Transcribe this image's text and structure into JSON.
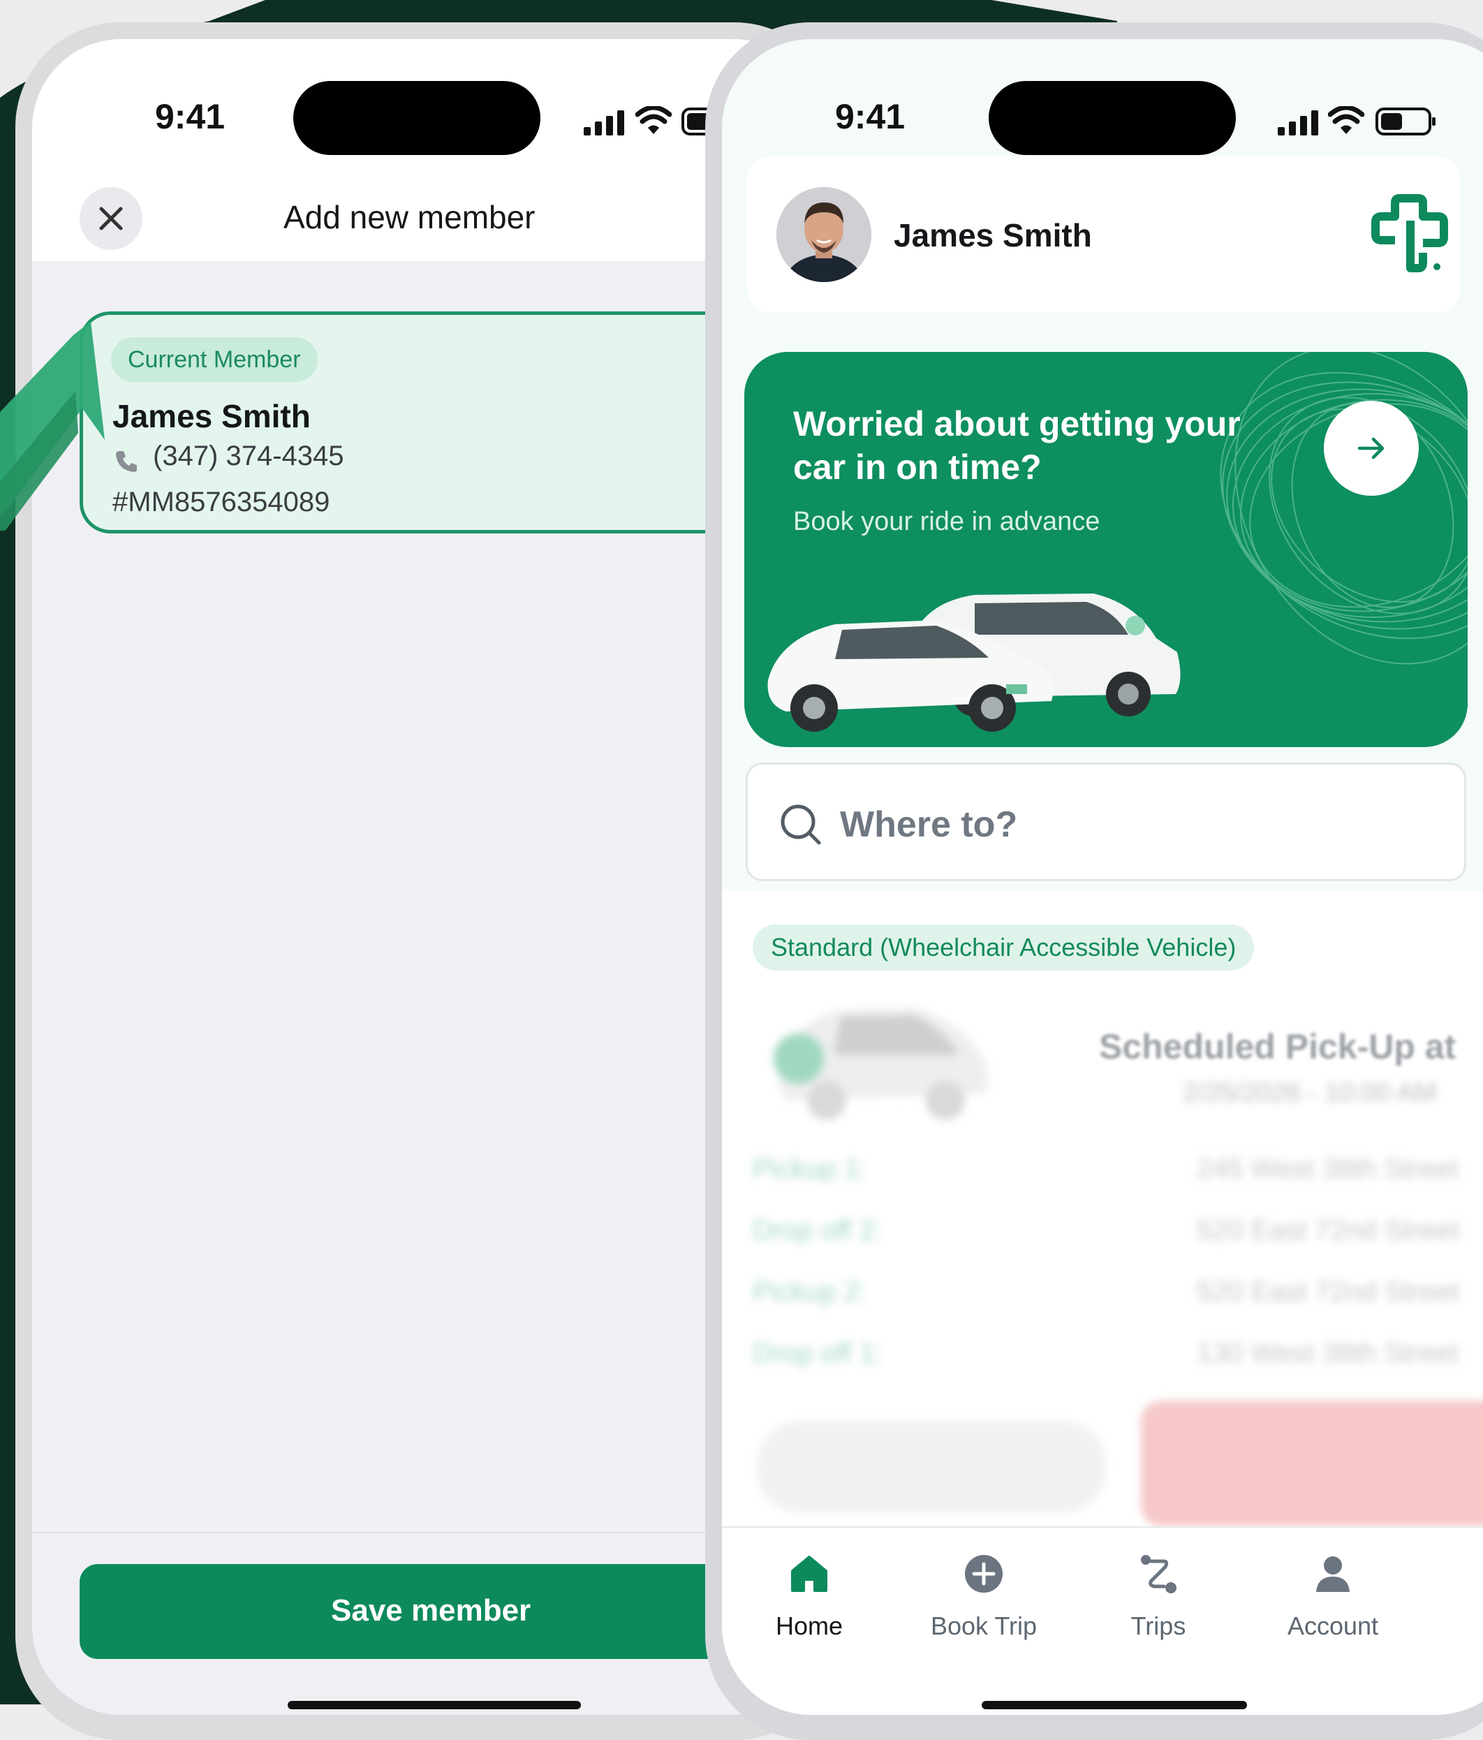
{
  "status_bar": {
    "time_left": "9:41",
    "time_right": "9:41"
  },
  "add_member_screen": {
    "title": "Add new member",
    "current_member": {
      "badge": "Current Member",
      "name": "James Smith",
      "phone": "(347) 374-4345",
      "member_id": "#MM8576354089"
    },
    "save_button": "Save member"
  },
  "home_screen": {
    "profile": {
      "name": "James Smith"
    },
    "promo": {
      "title": "Worried about getting your car in on time?",
      "subtitle": "Book your ride in advance"
    },
    "search": {
      "placeholder": "Where to?"
    },
    "trip": {
      "vehicle_badge": "Standard (Wheelchair Accessible Vehicle)",
      "scheduled_label": "Scheduled Pick-Up at",
      "scheduled_date": "2/25/2026 - 10:00 AM",
      "stops": [
        {
          "label": "Pickup 1:",
          "address": "245 West 38th Street"
        },
        {
          "label": "Drop off 2:",
          "address": "520 East 72nd Street"
        },
        {
          "label": "Pickup 2:",
          "address": "520 East 72nd Street"
        },
        {
          "label": "Drop off 1:",
          "address": "130 West 38th Street"
        }
      ]
    },
    "tabs": [
      {
        "label": "Home",
        "icon": "home-icon",
        "active": true
      },
      {
        "label": "Book Trip",
        "icon": "plus-circle-icon",
        "active": false
      },
      {
        "label": "Trips",
        "icon": "route-icon",
        "active": false
      },
      {
        "label": "Account",
        "icon": "person-icon",
        "active": false
      }
    ]
  },
  "colors": {
    "brand_green": "#0d8a5c",
    "dark_background": "#0e2f24",
    "badge_green_bg": "#dff3ea",
    "blurred_button_red": "#f6c8c8"
  }
}
